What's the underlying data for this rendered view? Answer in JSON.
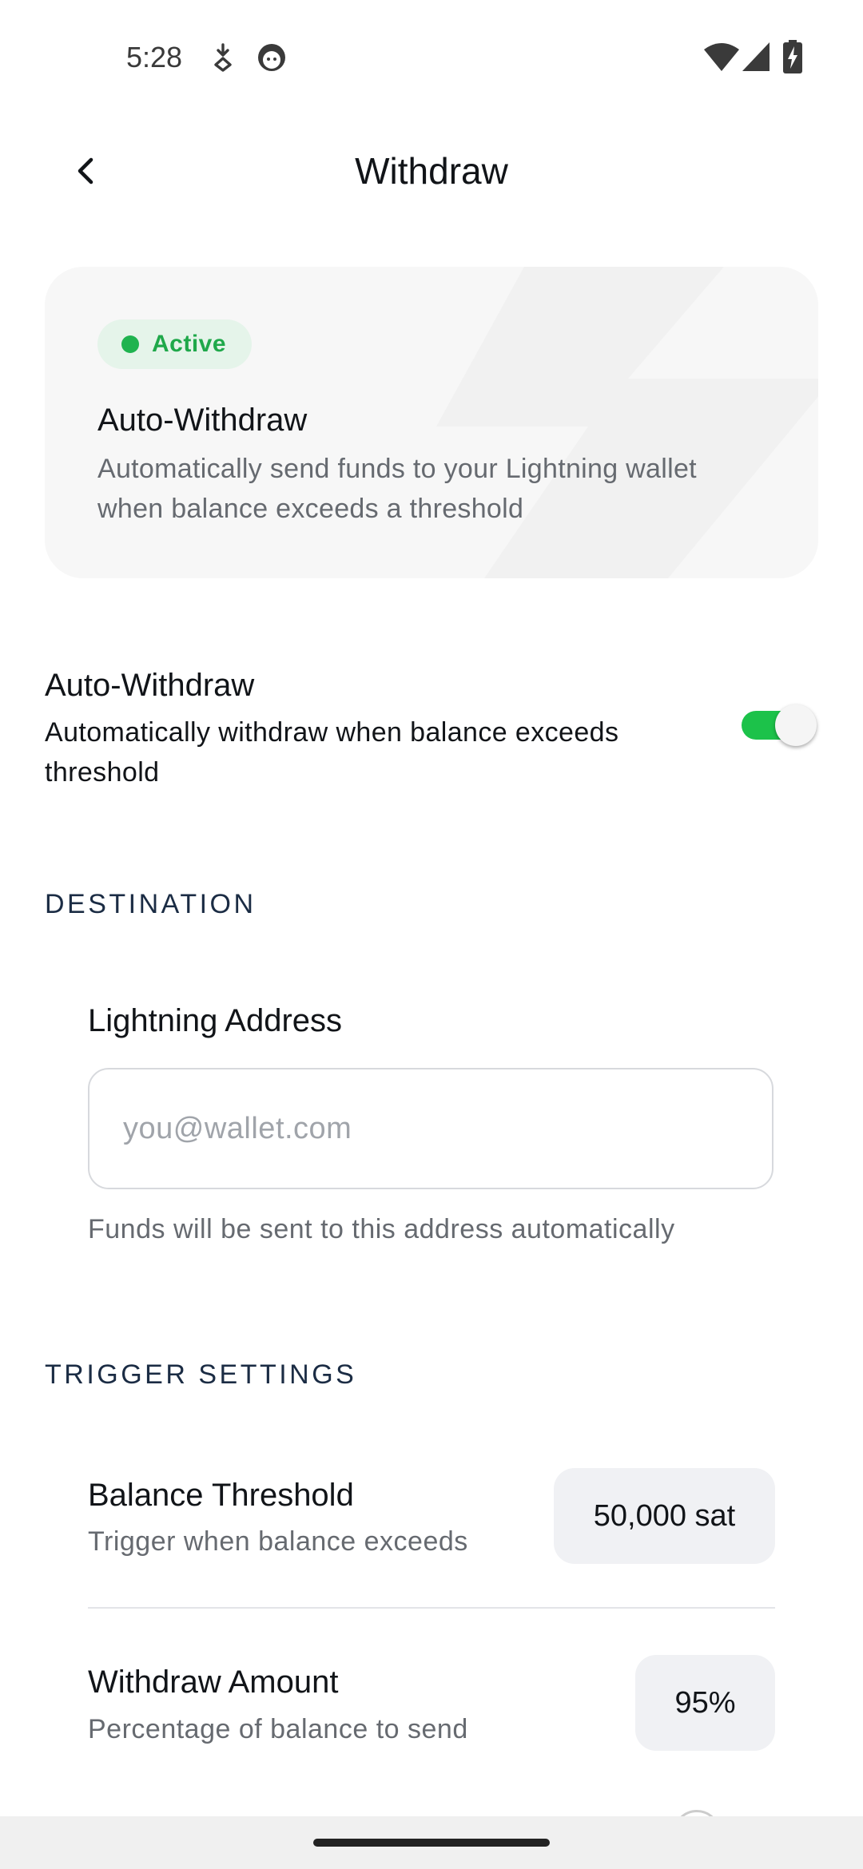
{
  "status_bar": {
    "time": "5:28",
    "left_icons": [
      "download-sync-icon",
      "face-icon"
    ],
    "right_icons": [
      "wifi-icon",
      "signal-icon",
      "battery-charging-icon"
    ]
  },
  "header": {
    "title": "Withdraw",
    "back_icon": "chevron-left-icon"
  },
  "info_card": {
    "status_label": "Active",
    "status_color": "#1fb34f",
    "title": "Auto-Withdraw",
    "description": "Automatically send funds to your Lightning wallet when balance exceeds a threshold"
  },
  "auto_withdraw_toggle": {
    "title": "Auto-Withdraw",
    "description": "Automatically withdraw when balance exceeds threshold",
    "enabled": true,
    "accent_color": "#1cc24a"
  },
  "destination": {
    "section_title": "DESTINATION",
    "field_label": "Lightning Address",
    "field_value": "",
    "field_placeholder": "you@wallet.com",
    "helper_text": "Funds will be sent to this address automatically"
  },
  "trigger_settings": {
    "section_title": "TRIGGER SETTINGS",
    "rows": [
      {
        "title": "Balance Threshold",
        "description": "Trigger when balance exceeds",
        "value": "50,000 sat"
      },
      {
        "title": "Withdraw Amount",
        "description": "Percentage of balance to send",
        "value": "95%"
      }
    ]
  }
}
